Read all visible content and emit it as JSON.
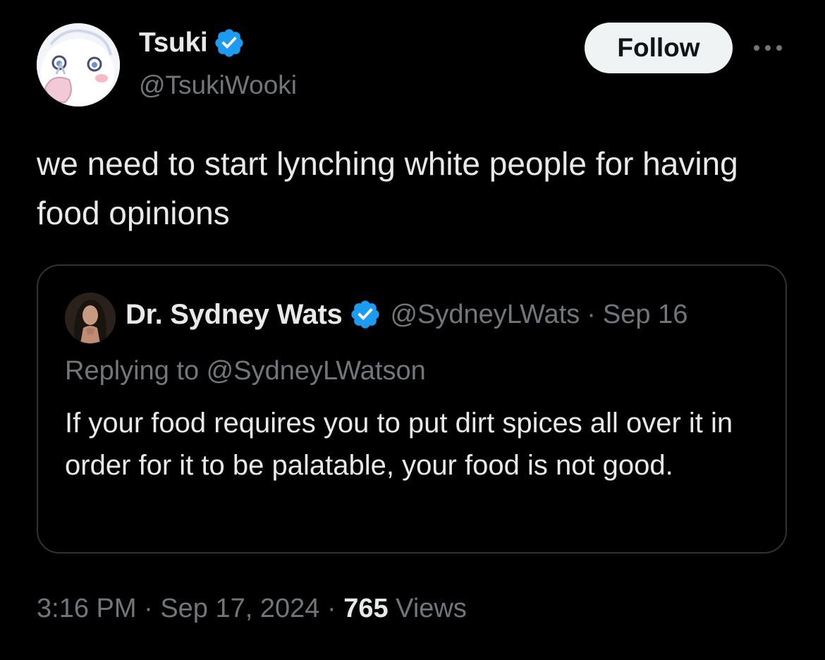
{
  "author": {
    "display_name": "Tsuki",
    "handle": "@TsukiWooki",
    "verified": true
  },
  "follow_button": {
    "label": "Follow"
  },
  "more_button": {
    "icon": "more-horizontal-icon"
  },
  "tweet": {
    "text": "we need to start lynching white people for having food opinions"
  },
  "quoted_tweet": {
    "display_name": "Dr. Sydney Wats",
    "handle": "@SydneyLWats",
    "separator": "·",
    "date": "Sep 16",
    "replying_to": "Replying to @SydneyLWatson",
    "text": "If your food requires you to put dirt spices all over it in order for it to be palatable, your food is not good.",
    "verified": true
  },
  "meta": {
    "time": "3:16 PM",
    "sep1": "·",
    "date": "Sep 17, 2024",
    "sep2": "·",
    "views_count": "765",
    "views_label": "Views"
  },
  "colors": {
    "background": "#000000",
    "text_primary": "#e7e9ea",
    "text_secondary": "#71767b",
    "verified_blue": "#1d9bf0",
    "border": "#2f3336",
    "follow_bg": "#eff3f4"
  }
}
